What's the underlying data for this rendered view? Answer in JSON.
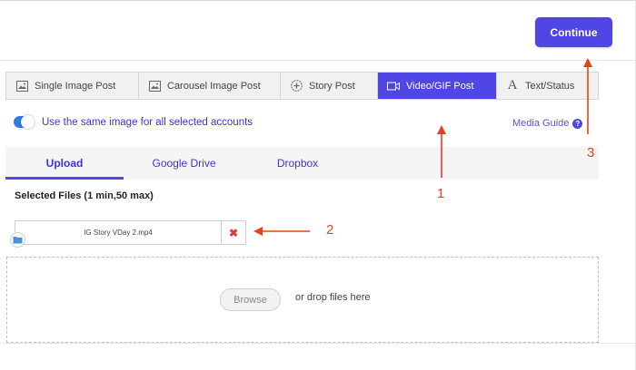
{
  "header": {
    "continue_label": "Continue"
  },
  "post_types": [
    {
      "label": "Single Image Post",
      "icon": "image-icon",
      "active": false
    },
    {
      "label": "Carousel Image Post",
      "icon": "image-icon",
      "active": false
    },
    {
      "label": "Story Post",
      "icon": "plus-circle-icon",
      "active": false
    },
    {
      "label": "Video/GIF Post",
      "icon": "video-icon",
      "active": true
    },
    {
      "label": "Text/Status",
      "icon": "text-icon",
      "active": false
    }
  ],
  "options": {
    "same_image_label": "Use the same image for all selected accounts",
    "toggle_on": true,
    "media_guide_label": "Media Guide",
    "media_guide_icon": "?"
  },
  "sources": [
    {
      "label": "Upload",
      "active": true
    },
    {
      "label": "Google Drive",
      "active": false
    },
    {
      "label": "Dropbox",
      "active": false
    }
  ],
  "files": {
    "heading": "Selected Files (1 min,50 max)",
    "items": [
      {
        "name": "IG Story VDay 2.mp4",
        "remove_icon": "✖"
      }
    ]
  },
  "dropzone": {
    "browse_label": "Browse",
    "drop_text": "or drop files here"
  },
  "annotations": {
    "one": "1",
    "two": "2",
    "three": "3",
    "color": "#e8401c"
  },
  "colors": {
    "accent": "#4f46e5",
    "toggle": "#2f7de1",
    "remove": "#e53935"
  }
}
